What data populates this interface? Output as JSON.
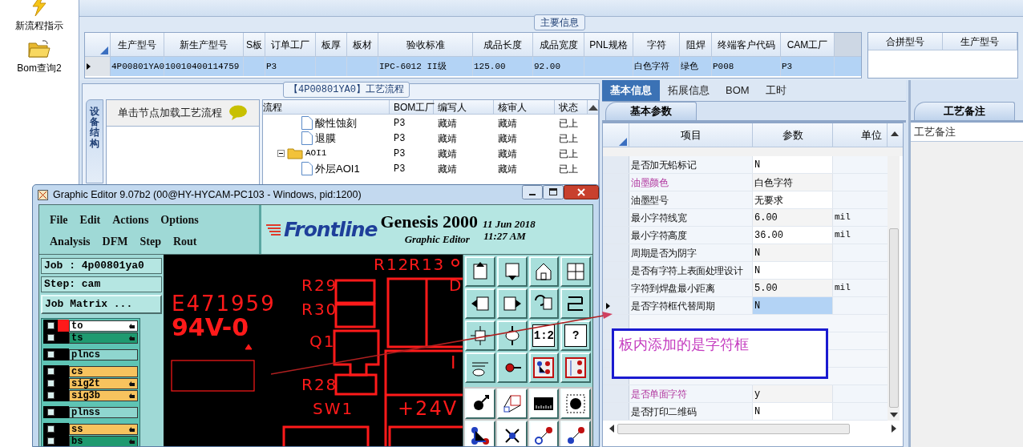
{
  "sidebar": {
    "items": [
      {
        "label": "新流程指示",
        "kind": "lightning"
      },
      {
        "label": "Bom查询2",
        "kind": "folder"
      }
    ]
  },
  "main_info": {
    "title": "主要信息",
    "columns": [
      "生产型号",
      "新生产型号",
      "S板",
      "订单工厂",
      "板厚",
      "板材",
      "验收标准",
      "成品长度",
      "成品宽度",
      "PNL规格",
      "字符",
      "阻焊",
      "终端客户代码",
      "CAM工厂"
    ],
    "rows": [
      {
        "selected": true,
        "cells": [
          "4P00801YA0",
          "10010400114759",
          "",
          "P3",
          "",
          "",
          "IPC-6012 II级",
          "125.00",
          "92.00",
          "",
          "白色字符",
          "绿色",
          "P008",
          "P3"
        ]
      }
    ]
  },
  "merge_table": {
    "columns": [
      "合拼型号",
      "生产型号"
    ]
  },
  "process_flow": {
    "title": "【4P00801YA0】工艺流程",
    "side_tab": "设备结构",
    "hint": "单击节点加载工艺流程",
    "columns": [
      "流程",
      "BOM工厂",
      "编写人",
      "核审人",
      "状态"
    ],
    "nodes": [
      {
        "kind": "step",
        "label": "酸性蚀刻",
        "cells": [
          "P3",
          "藏靖",
          "藏靖",
          "已上"
        ]
      },
      {
        "kind": "step",
        "label": "退膜",
        "cells": [
          "P3",
          "藏靖",
          "藏靖",
          "已上"
        ]
      },
      {
        "kind": "folder",
        "label": "AOI1",
        "expanded": true,
        "cells": [
          "P3",
          "藏靖",
          "藏靖",
          "已上"
        ],
        "children": [
          {
            "kind": "step",
            "label": "外层AOI1",
            "cells": [
              "P3",
              "藏靖",
              "藏靖",
              "已上"
            ]
          }
        ]
      }
    ]
  },
  "detail": {
    "tabs": [
      {
        "label": "基本信息",
        "selected": true
      },
      {
        "label": "拓展信息",
        "selected": false
      },
      {
        "label": "BOM",
        "selected": false
      },
      {
        "label": "工时",
        "selected": false
      }
    ],
    "sub_tab": "基本参数",
    "columns": [
      "项目",
      "参数",
      "单位"
    ],
    "params": [
      {
        "kind": "row",
        "label": "是否加无铅标记",
        "value": "N",
        "highlight": false,
        "selected": false
      },
      {
        "kind": "row",
        "label": "油墨颜色",
        "value": "白色字符",
        "highlight": true,
        "selected": false
      },
      {
        "kind": "row",
        "label": "油墨型号",
        "value": "无要求",
        "highlight": false,
        "selected": false
      },
      {
        "kind": "row",
        "label": "最小字符线宽",
        "value": "6.00",
        "unit": "mil",
        "highlight": false,
        "selected": false
      },
      {
        "kind": "row",
        "label": "最小字符高度",
        "value": "36.00",
        "unit": "mil",
        "highlight": false,
        "selected": false
      },
      {
        "kind": "row",
        "label": "周期是否为阴字",
        "value": "N",
        "highlight": false,
        "selected": false
      },
      {
        "kind": "row",
        "label": "是否有字符上表面处理设计",
        "value": "N",
        "highlight": false,
        "selected": false
      },
      {
        "kind": "row",
        "label": "字符到焊盘最小距离",
        "value": "5.00",
        "unit": "mil",
        "highlight": false,
        "selected": false
      },
      {
        "kind": "row",
        "label": "是否字符框代替周期",
        "value": "N",
        "highlight": false,
        "selected": true
      },
      {
        "kind": "blank"
      },
      {
        "kind": "blank"
      },
      {
        "kind": "blank"
      },
      {
        "kind": "blank"
      },
      {
        "kind": "row",
        "label": "是否单面字符",
        "value": "y",
        "highlight": true,
        "selected": false
      },
      {
        "kind": "row",
        "label": "是否打印二维码",
        "value": "N",
        "highlight": false,
        "selected": false
      }
    ]
  },
  "remarks": {
    "tab": "工艺备注",
    "header": "工艺备注"
  },
  "annotation": {
    "text": "板内添加的是字符框"
  },
  "editor": {
    "title": "Graphic Editor 9.07b2 (00@HY-HYCAM-PC103 - Windows, pid:1200)",
    "menu_rows": [
      [
        "File",
        "Edit",
        "Actions",
        "Options"
      ],
      [
        "Analysis",
        "DFM",
        "Step",
        "Rout"
      ]
    ],
    "logo": "Frontline",
    "product": "Genesis 2000",
    "subtitle": "Graphic Editor",
    "date": "11 Jun 2018",
    "time": "11:27 AM",
    "job": "Job : 4p00801ya0",
    "step": "Step: cam",
    "job_matrix": "Job Matrix ...",
    "layer_groups": [
      [
        {
          "name": "to",
          "color": "#ffffff",
          "selected": true,
          "checked": false,
          "affected": true
        },
        {
          "name": "ts",
          "color": "#1f9a70",
          "selected": false,
          "checked": false,
          "affected": true
        }
      ],
      [
        {
          "name": "plncs",
          "color": "#8fd6cf",
          "selected": false,
          "checked": false,
          "affected": false
        }
      ],
      [
        {
          "name": "cs",
          "color": "#f7c35e",
          "selected": false,
          "checked": false,
          "affected": false
        },
        {
          "name": "sig2t",
          "color": "#f7c35e",
          "selected": false,
          "checked": false,
          "affected": true
        },
        {
          "name": "sig3b",
          "color": "#f7c35e",
          "selected": false,
          "checked": false,
          "affected": true
        }
      ],
      [
        {
          "name": "plnss",
          "color": "#8fd6cf",
          "selected": false,
          "checked": false,
          "affected": false
        }
      ],
      [
        {
          "name": "ss",
          "color": "#f7c35e",
          "selected": false,
          "checked": false,
          "affected": true
        },
        {
          "name": "bs",
          "color": "#1f9a70",
          "selected": false,
          "checked": false,
          "affected": true
        }
      ]
    ],
    "canvas_labels": [
      "E471959",
      "94V-0",
      "R29",
      "R30",
      "Q1",
      "R28",
      "SW1",
      "R12",
      "R13",
      "D",
      "I",
      "+24V"
    ],
    "tools": [
      {
        "kind": "icon"
      },
      {
        "kind": "icon"
      },
      {
        "kind": "icon"
      },
      {
        "kind": "icon"
      },
      {
        "kind": "icon"
      },
      {
        "kind": "icon"
      },
      {
        "kind": "icon"
      },
      {
        "kind": "icon"
      },
      {
        "kind": "icon"
      },
      {
        "kind": "icon"
      },
      {
        "kind": "text",
        "label": "1:2"
      },
      {
        "kind": "text",
        "label": "?"
      },
      {
        "kind": "icon"
      },
      {
        "kind": "icon"
      },
      {
        "kind": "icon"
      },
      {
        "kind": "icon"
      }
    ],
    "tools2": [
      {
        "kind": "icon"
      },
      {
        "kind": "icon"
      },
      {
        "kind": "icon"
      },
      {
        "kind": "icon"
      },
      {
        "kind": "icon"
      },
      {
        "kind": "icon"
      },
      {
        "kind": "icon"
      },
      {
        "kind": "icon"
      }
    ]
  }
}
